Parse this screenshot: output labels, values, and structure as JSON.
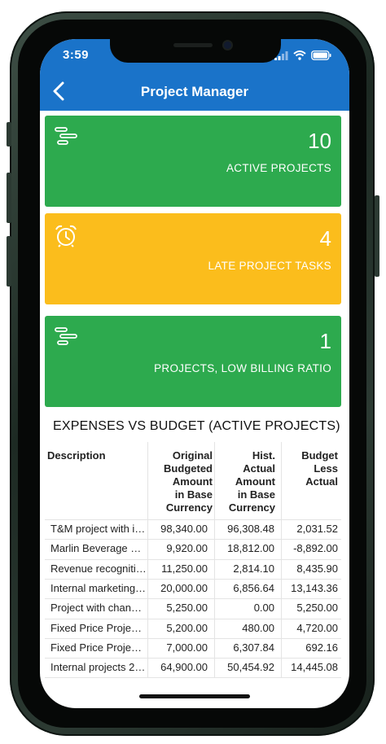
{
  "status": {
    "time": "3:59"
  },
  "header": {
    "title": "Project Manager"
  },
  "cards": [
    {
      "value": "10",
      "label": "ACTIVE PROJECTS",
      "color": "#2daa4e",
      "icon": "gantt-icon"
    },
    {
      "value": "4",
      "label": "LATE PROJECT TASKS",
      "color": "#fbbd1c",
      "icon": "alarm-clock-icon"
    },
    {
      "value": "1",
      "label": "PROJECTS, LOW BILLING RATIO",
      "color": "#2daa4e",
      "icon": "gantt-icon"
    }
  ],
  "section": {
    "title": "EXPENSES VS BUDGET (ACTIVE PROJECTS)"
  },
  "table": {
    "headers": [
      [
        "Description"
      ],
      [
        "Original",
        "Budgeted",
        "Amount",
        "in Base",
        "Currency"
      ],
      [
        "Hist.",
        "Actual",
        "Amount",
        "in Base",
        "Currency"
      ],
      [
        "Budget",
        "Less",
        "Actual"
      ]
    ],
    "rows": [
      [
        "T&M project with i…",
        "98,340.00",
        "96,308.48",
        "2,031.52"
      ],
      [
        "Marlin Beverage …",
        "9,920.00",
        "18,812.00",
        "-8,892.00"
      ],
      [
        "Revenue recogniti…",
        "11,250.00",
        "2,814.10",
        "8,435.90"
      ],
      [
        "Internal marketing…",
        "20,000.00",
        "6,856.64",
        "13,143.36"
      ],
      [
        "Project with chan…",
        "5,250.00",
        "0.00",
        "5,250.00"
      ],
      [
        "Fixed Price Proje…",
        "5,200.00",
        "480.00",
        "4,720.00"
      ],
      [
        "Fixed Price Proje…",
        "7,000.00",
        "6,307.84",
        "692.16"
      ],
      [
        "Internal projects 2…",
        "64,900.00",
        "50,454.92",
        "14,445.08"
      ]
    ]
  },
  "colors": {
    "appbar": "#1a73c9",
    "green": "#2daa4e",
    "yellow": "#fbbd1c"
  }
}
